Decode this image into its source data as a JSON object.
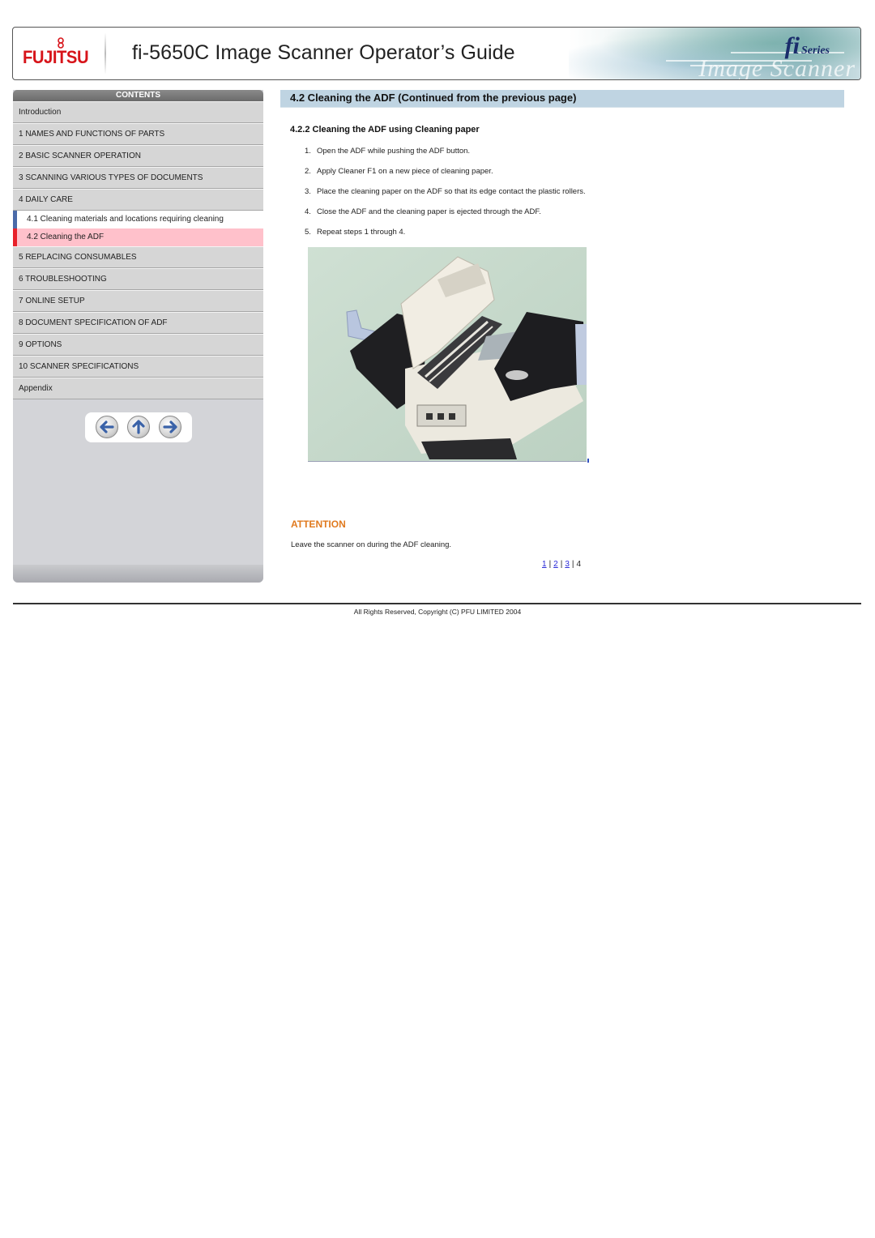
{
  "header": {
    "brand": "FUJITSU",
    "title": "fi-5650C Image Scanner Operator’s Guide",
    "series_badge_fi": "fi",
    "series_badge_label": "Series",
    "art_text": "Image Scanner"
  },
  "sidebar": {
    "contents_label": "CONTENTS",
    "items": [
      {
        "label": "Introduction"
      },
      {
        "label": "1 NAMES AND FUNCTIONS OF PARTS"
      },
      {
        "label": "2 BASIC SCANNER OPERATION"
      },
      {
        "label": "3 SCANNING VARIOUS TYPES OF DOCUMENTS"
      },
      {
        "label": "4 DAILY CARE"
      }
    ],
    "subitems": [
      {
        "label": "4.1 Cleaning materials and locations requiring cleaning",
        "marker_color": "#4a6aa8"
      },
      {
        "label": "4.2 Cleaning the ADF",
        "marker_color": "#e8202a",
        "active": true
      }
    ],
    "items_after": [
      {
        "label": "5 REPLACING CONSUMABLES"
      },
      {
        "label": "6 TROUBLESHOOTING"
      },
      {
        "label": "7 ONLINE SETUP"
      },
      {
        "label": "8 DOCUMENT SPECIFICATION OF ADF"
      },
      {
        "label": "9 OPTIONS"
      },
      {
        "label": "10 SCANNER SPECIFICATIONS"
      },
      {
        "label": "Appendix"
      }
    ],
    "nav_buttons": [
      {
        "icon": "arrow-left-icon",
        "label": "Previous"
      },
      {
        "icon": "arrow-up-icon",
        "label": "Top"
      },
      {
        "icon": "arrow-right-icon",
        "label": "Next"
      }
    ]
  },
  "main": {
    "section_title": "4.2 Cleaning the ADF (Continued from the previous page)",
    "subsection_title": "4.2.2 Cleaning the ADF using Cleaning paper",
    "steps": [
      {
        "num": "1.",
        "text": "Open the ADF while pushing the ADF button."
      },
      {
        "num": "2.",
        "text": "Apply Cleaner F1 on a new piece of cleaning paper."
      },
      {
        "num": "3.",
        "text": "Place the cleaning paper on the ADF so that its edge contact the plastic rollers."
      },
      {
        "num": "4.",
        "text": "Close the ADF and the cleaning paper is ejected through the ADF."
      },
      {
        "num": "5.",
        "text": "Repeat steps 1 through 4."
      }
    ],
    "photo_alt": "Scanner with ADF open",
    "attention_heading": "ATTENTION",
    "attention_text": "Leave the scanner on during the ADF cleaning.",
    "pager": {
      "pages": [
        "1",
        "2",
        "3",
        "4"
      ],
      "current": "4",
      "separator": "|"
    }
  },
  "footer": {
    "copyright": "All Rights Reserved, Copyright (C) PFU LIMITED 2004"
  },
  "colors": {
    "section_bar": "#bfd4e2",
    "attention": "#e07a1f",
    "active_item_bg": "#ffc1cb",
    "link": "#2a2ad8",
    "brand_red": "#d7141a"
  }
}
